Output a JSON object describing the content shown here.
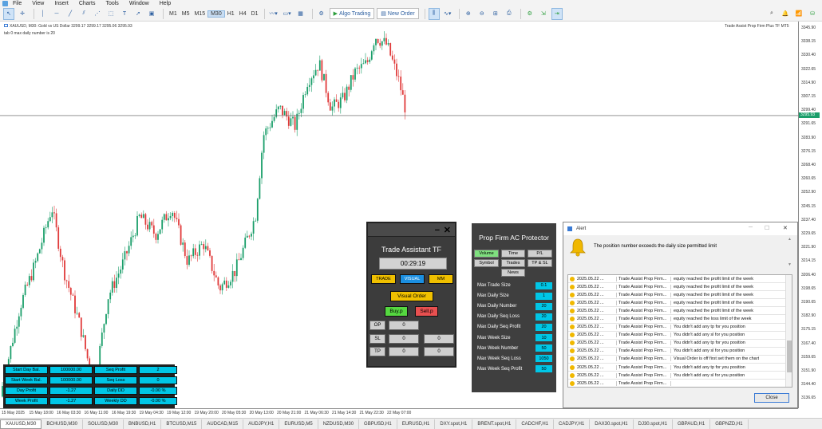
{
  "menu": {
    "file": "File",
    "view": "View",
    "insert": "Insert",
    "charts": "Charts",
    "tools": "Tools",
    "window": "Window",
    "help": "Help"
  },
  "toolbar": {
    "timeframes": [
      "M1",
      "M5",
      "M15",
      "M30",
      "H1",
      "H4",
      "D1"
    ],
    "selected_tf": "M30",
    "algo": "Algo Trading",
    "new_order": "New Order"
  },
  "chart": {
    "symbol_line": "XAUUSD, M30: Gold vs US Dollar  3299.17 3299.17 3295.06 3295.93",
    "tab_info": "tab 0 max daily number is 20",
    "ea_name": "Trade Assist Prop Firm Plus TF MT5",
    "current_price": "3295.93",
    "current_price_value": 3295.93,
    "price_labels": [
      "3345.90",
      "3338.15",
      "3330.40",
      "3322.65",
      "3314.90",
      "3307.15",
      "3299.40",
      "3291.65",
      "3283.90",
      "3276.15",
      "3268.40",
      "3260.65",
      "3252.90",
      "3245.15",
      "3237.40",
      "3229.65",
      "3221.90",
      "3214.15",
      "3206.40",
      "3198.65",
      "3190.65",
      "3182.90",
      "3175.15",
      "3167.40",
      "3159.65",
      "3151.90",
      "3144.40",
      "3136.65"
    ],
    "time_labels": [
      "15 May 2025",
      "15 May 18:00",
      "16 May 03:30",
      "16 May 11:00",
      "16 May 19:30",
      "19 May 04:30",
      "19 May 12:00",
      "19 May 20:00",
      "20 May 05:30",
      "20 May 13:00",
      "20 May 21:00",
      "21 May 06:30",
      "21 May 14:30",
      "21 May 22:30",
      "22 May 07:00"
    ]
  },
  "stats": {
    "rows": [
      [
        "Start Day Bal.",
        "100000.00",
        "Seq Profit",
        "2"
      ],
      [
        "Start Week Bal.",
        "100000.00",
        "Seq Loss",
        "0"
      ],
      [
        "Day Profit",
        "-1.27",
        "Daily DD",
        "-0.00 %"
      ],
      [
        "Week Profit",
        "-1.27",
        "Weekly DD",
        "-0.00 %"
      ]
    ]
  },
  "tatf": {
    "minimize": "−",
    "close": "✕",
    "title": "Trade Assistant TF",
    "timer": "00:29:19",
    "trade": "TRADE",
    "visual": "VISUAL",
    "mm": "MM",
    "visual_order": "Visual Order",
    "buy": "Buy.p",
    "sell": "Sell.p",
    "op": "OP",
    "op_val": "0",
    "sl": "SL",
    "sl_v1": "0",
    "sl_v2": "0",
    "tp": "TP",
    "tp_v1": "0",
    "tp_v2": "0"
  },
  "pfac": {
    "title": "Prop Firm AC Protector",
    "tabs": [
      "Volume",
      "Time",
      "P/L",
      "Symbol",
      "Trades",
      "TP & SL",
      "News"
    ],
    "rows": [
      [
        "Max Trade Size",
        "0.1"
      ],
      [
        "Max Daily Size",
        "1"
      ],
      [
        "Max Daily Number",
        "20"
      ],
      [
        "Max Daily Seq Loss",
        "20"
      ],
      [
        "Max Daily Seq Profit",
        "20"
      ],
      [
        "Max Week Size",
        "10"
      ],
      [
        "Max Week Number",
        "50"
      ],
      [
        "Max Week Seq Loss",
        "1050"
      ],
      [
        "Max Week Seq Profit",
        "50"
      ]
    ]
  },
  "alert": {
    "title": "Alert",
    "message": "The position number exceeds the daily size permitted limit",
    "close": "Close",
    "rows": [
      [
        "2025.05.22 ...",
        "Trade Assist Prop Firm...",
        "equity reached the profit limit of the week"
      ],
      [
        "2025.05.22 ...",
        "Trade Assist Prop Firm...",
        "equity reached the profit limit of the week"
      ],
      [
        "2025.05.22 ...",
        "Trade Assist Prop Firm...",
        "equity reached the profit limit of the week"
      ],
      [
        "2025.05.22 ...",
        "Trade Assist Prop Firm...",
        "equity reached the profit limit of the week"
      ],
      [
        "2025.05.22 ...",
        "Trade Assist Prop Firm...",
        "equity reached the profit limit of the week"
      ],
      [
        "2025.05.22 ...",
        "Trade Assist Prop Firm...",
        "equity reached the loss limit of the week"
      ],
      [
        "2025.05.22 ...",
        "Trade Assist Prop Firm...",
        "You didn't add any tp for you position"
      ],
      [
        "2025.05.22 ...",
        "Trade Assist Prop Firm...",
        "You didn't add any sl for you position"
      ],
      [
        "2025.05.22 ...",
        "Trade Assist Prop Firm...",
        "You didn't add any tp for you position"
      ],
      [
        "2025.05.22 ...",
        "Trade Assist Prop Firm...",
        "You didn't add any sl for you position"
      ],
      [
        "2025.05.22 ...",
        "Trade Assist Prop Firm...",
        "Visual Order is off first set them on the chart"
      ],
      [
        "2025.05.22 ...",
        "Trade Assist Prop Firm...",
        "You didn't add any tp for you position"
      ],
      [
        "2025.05.22 ...",
        "Trade Assist Prop Firm...",
        "You didn't add any sl for you position"
      ],
      [
        "2025.05.22 ...",
        "Trade Assist Prop Firm...",
        ""
      ]
    ]
  },
  "bottom_tabs": [
    "XAUUSD,M30",
    "BCHUSD,M30",
    "SOLUSD,M30",
    "BNBUSD,H1",
    "BTCUSD,M15",
    "AUDCAD,M15",
    "AUDJPY,H1",
    "EURUSD,M5",
    "NZDUSD,M30",
    "GBPUSD,H1",
    "EURUSD,H1",
    "DXY.spot,H1",
    "BRENT.spot,H1",
    "CADCHF,H1",
    "CADJPY,H1",
    "DAX30.spot,H1",
    "DJ30.spot,H1",
    "GBPAUD,H1",
    "GBPNZD,H1"
  ],
  "colors": {
    "bull": "#1a9e6a",
    "bear": "#e03a3a",
    "panel_cyan": "#00c6e6"
  }
}
